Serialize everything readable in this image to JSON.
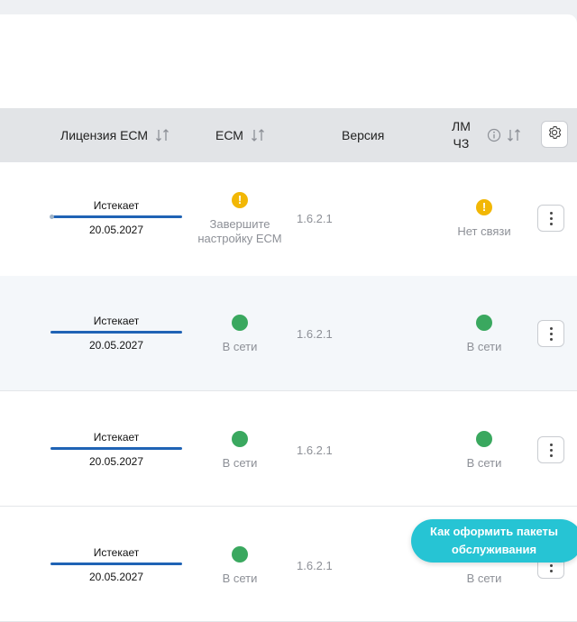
{
  "table": {
    "headers": {
      "license": "Лицензия ЕСМ",
      "ecm": "ЕСМ",
      "version": "Версия",
      "lm_line1": "ЛМ",
      "lm_line2": "ЧЗ"
    },
    "rows": [
      {
        "license_label": "Истекает",
        "license_date": "20.05.2027",
        "ecm_status": "warning",
        "ecm_text_line1": "Завершите",
        "ecm_text_line2": "настройку ЕСМ",
        "version": "1.6.2.1",
        "lm_status": "warning",
        "lm_text": "Нет связи"
      },
      {
        "license_label": "Истекает",
        "license_date": "20.05.2027",
        "ecm_status": "online",
        "ecm_text": "В сети",
        "version": "1.6.2.1",
        "lm_status": "online",
        "lm_text": "В сети"
      },
      {
        "license_label": "Истекает",
        "license_date": "20.05.2027",
        "ecm_status": "online",
        "ecm_text": "В сети",
        "version": "1.6.2.1",
        "lm_status": "online",
        "lm_text": "В сети"
      },
      {
        "license_label": "Истекает",
        "license_date": "20.05.2027",
        "ecm_status": "online",
        "ecm_text": "В сети",
        "version": "1.6.2.1",
        "lm_status": "online",
        "lm_text": "В сети"
      }
    ]
  },
  "help_button": {
    "line1": "Как оформить пакеты",
    "line2": "обслуживания"
  },
  "colors": {
    "online": "#3aa85f",
    "warning": "#f2b705",
    "accent": "#26c4d4",
    "license_bar": "#1f63b5"
  },
  "icons": {
    "sort": "sort-arrows-icon",
    "info": "info-icon",
    "settings": "gear-icon",
    "row_menu": "kebab-menu-icon"
  }
}
